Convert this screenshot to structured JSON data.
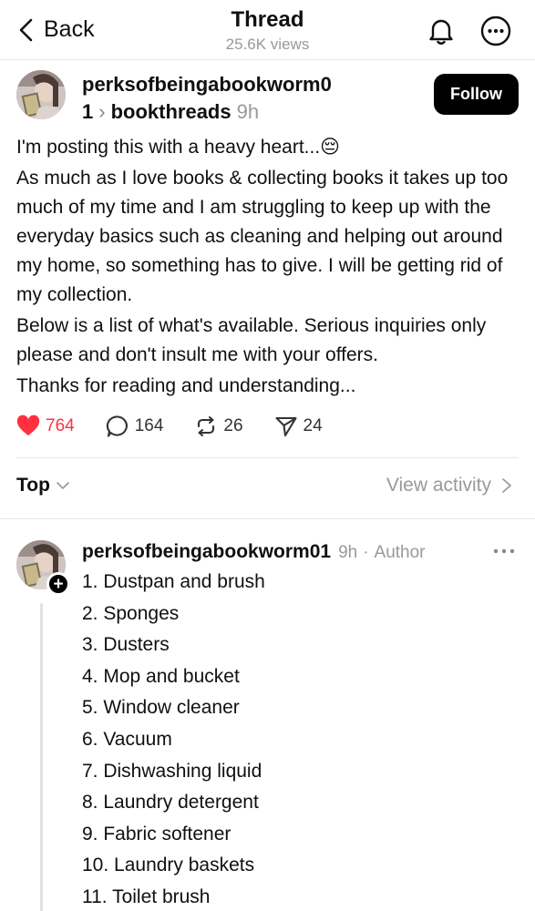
{
  "header": {
    "back_label": "Back",
    "title": "Thread",
    "views": "25.6K views"
  },
  "post": {
    "handle": "perksofbeingabookworm01",
    "community": "bookthreads",
    "time": "9h",
    "follow_label": "Follow",
    "paragraphs": [
      "I'm posting this with a heavy heart...😔",
      "As much as I love books & collecting books it takes up too much of my time and I am struggling to keep up with the everyday basics such as cleaning and helping out around my home, so something has to give. I will be getting rid of my collection.",
      "Below is a list of what's available. Serious inquiries only please and don't insult me with your offers.",
      "Thanks for reading and understanding..."
    ],
    "likes": "764",
    "replies": "164",
    "reposts": "26",
    "shares": "24",
    "like_color": "#ff3040"
  },
  "sort": {
    "label": "Top",
    "view_activity": "View activity"
  },
  "reply": {
    "handle": "perksofbeingabookworm01",
    "time": "9h",
    "separator": "·",
    "author_tag": "Author",
    "items": [
      "1. Dustpan and brush",
      "2. Sponges",
      "3. Dusters",
      "4. Mop and bucket",
      "5. Window cleaner",
      "6. Vacuum",
      "7. Dishwashing liquid",
      "8. Laundry detergent",
      "9. Fabric softener",
      "10. Laundry baskets",
      "11. Toilet brush"
    ]
  }
}
